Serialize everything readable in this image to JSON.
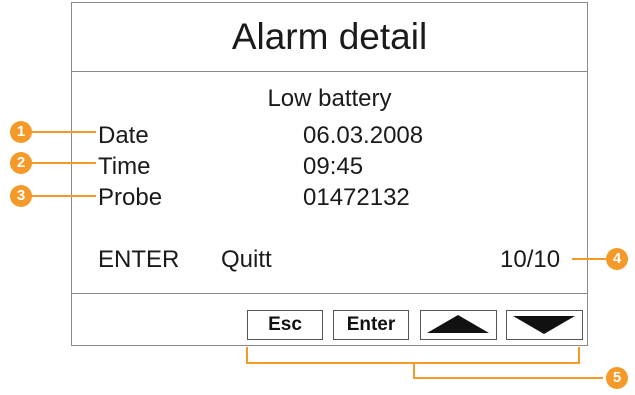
{
  "screen": {
    "title": "Alarm detail",
    "alarm_name": "Low battery",
    "rows": [
      {
        "label": "Date",
        "value": "06.03.2008"
      },
      {
        "label": "Time",
        "value": "09:45"
      },
      {
        "label": "Probe",
        "value": "01472132"
      }
    ],
    "enter_label": "ENTER",
    "quitt_label": "Quitt",
    "counter": "10/10"
  },
  "keys": {
    "esc_label": "Esc",
    "enter_label": "Enter",
    "up_icon": "triangle-up-icon",
    "down_icon": "triangle-down-icon"
  },
  "callouts": [
    "1",
    "2",
    "3",
    "4",
    "5"
  ],
  "colors": {
    "callout": "#f59a28",
    "border": "#8a8a8a",
    "text": "#1a1a1a"
  }
}
